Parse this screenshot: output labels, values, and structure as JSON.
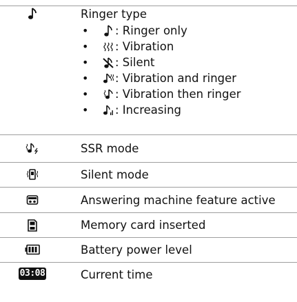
{
  "rows": [
    {
      "label": "Ringer type",
      "icon": "music-note-icon",
      "options": [
        {
          "icon": "music-note-icon",
          "text": ": Ringer only"
        },
        {
          "icon": "vibration-icon",
          "text": ": Vibration"
        },
        {
          "icon": "muted-note-icon",
          "text": ": Silent"
        },
        {
          "icon": "vibration-and-ringer-icon",
          "text": ": Vibration and ringer"
        },
        {
          "icon": "vibration-then-ringer-icon",
          "text": ": Vibration then ringer"
        },
        {
          "icon": "increasing-ringer-icon",
          "text": ": Increasing"
        }
      ]
    },
    {
      "label": "SSR mode",
      "icon": "ssr-mode-icon"
    },
    {
      "label": "Silent mode",
      "icon": "silent-mode-icon"
    },
    {
      "label": "Answering machine feature active",
      "icon": "answering-machine-icon"
    },
    {
      "label": "Memory card inserted",
      "icon": "memory-card-icon"
    },
    {
      "label": "Battery power level",
      "icon": "battery-icon"
    },
    {
      "label": "Current time",
      "icon": "clock-icon",
      "time_digits": "03:08"
    }
  ],
  "bullet": "•",
  "colors": {
    "divider": "#9e9e9e",
    "icon": "#111111",
    "text": "#111111"
  }
}
